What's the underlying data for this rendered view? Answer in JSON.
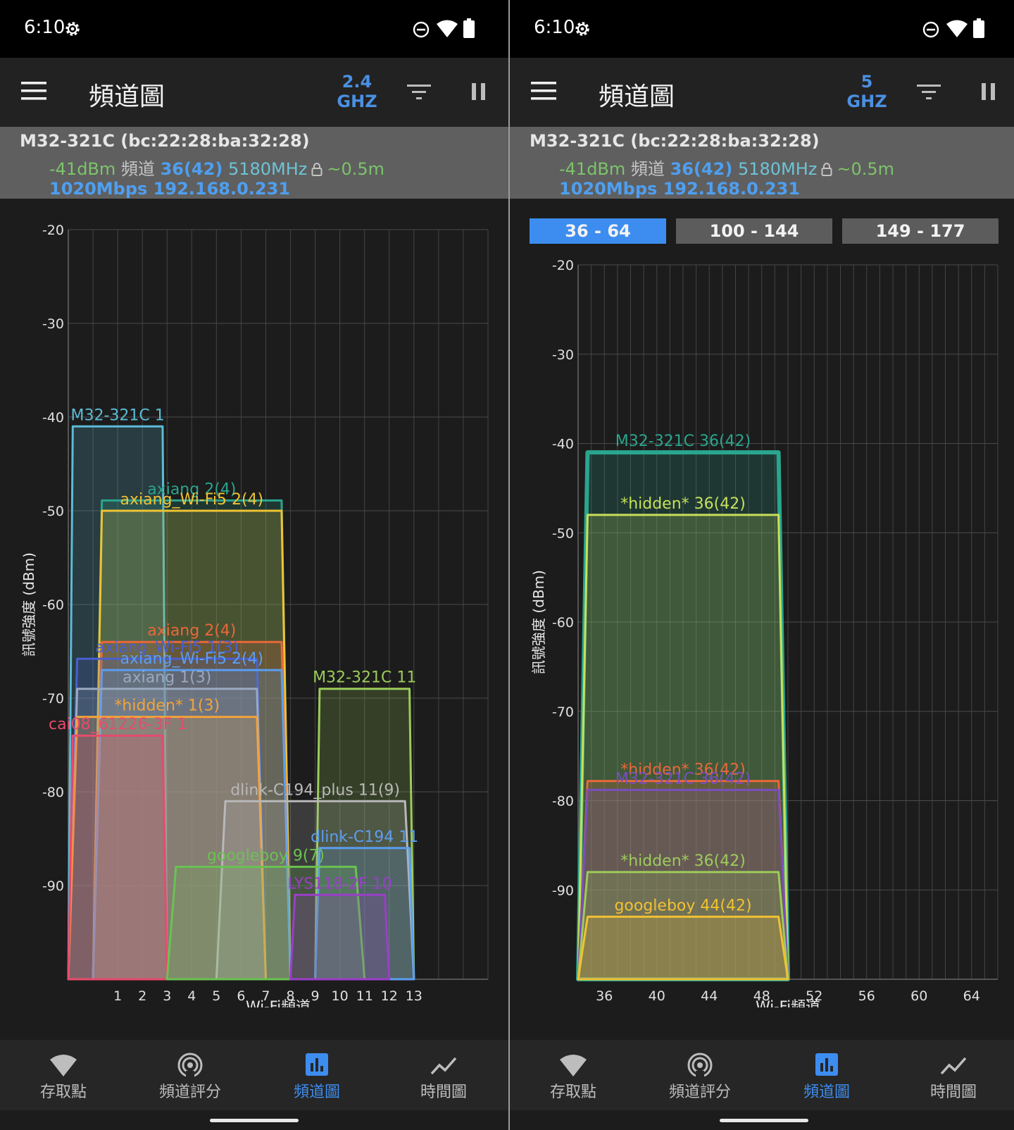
{
  "status": {
    "time": "6:10"
  },
  "app": {
    "title": "頻道圖"
  },
  "nav": [
    {
      "label": "存取點",
      "icon": "wifi-icon",
      "active": false
    },
    {
      "label": "頻道評分",
      "icon": "signal-rating-icon",
      "active": false
    },
    {
      "label": "頻道圖",
      "icon": "bar-chart-icon",
      "active": true
    },
    {
      "label": "時間圖",
      "icon": "line-chart-icon",
      "active": false
    }
  ],
  "connection": {
    "ssid": "M32-321C (bc:22:28:ba:32:28)",
    "signal": "-41dBm",
    "channel_label": "頻道",
    "channel": "36(42)",
    "frequency": "5180MHz",
    "distance": "~0.5m",
    "link": "1020Mbps 192.168.0.231"
  },
  "colors": {
    "accent": "#3d8df0",
    "signal_green": "#7cc46a",
    "ip_blue": "#4e9ff0",
    "info_bg": "#5f5f5f"
  },
  "screens": {
    "left": {
      "band_line1": "2.4",
      "band_line2": "GHZ",
      "chart_data": {
        "type": "area",
        "xlabel": "Wi-Fi頻道",
        "ylabel": "訊號強度 (dBm)",
        "ylim": [
          -100,
          -20
        ],
        "yticks": [
          -20,
          -30,
          -40,
          -50,
          -60,
          -70,
          -80,
          -90
        ],
        "xlim": [
          -1,
          16
        ],
        "xticks": [
          1,
          2,
          3,
          4,
          5,
          6,
          7,
          8,
          9,
          10,
          11,
          12,
          13
        ],
        "grid": true,
        "series": [
          {
            "name": "M32-321C 1",
            "from": -1,
            "to": 3,
            "level": -41,
            "color": "#5bbcd6"
          },
          {
            "name": "axiang 2(4)",
            "from": 0,
            "to": 8,
            "level": -48.9,
            "color": "#2aa58e"
          },
          {
            "name": "axiang_Wi-Fi5 2(4)",
            "from": 0,
            "to": 8,
            "level": -50,
            "color": "#f1c232"
          },
          {
            "name": "axiang 2(4)",
            "from": 0,
            "to": 8,
            "level": -64,
            "color": "#e9683a"
          },
          {
            "name": "axiang_Wi-Fi5 1(3)",
            "from": -1,
            "to": 7,
            "level": -65.8,
            "color": "#4a5fd0"
          },
          {
            "name": "axiang_Wi-Fi5 2(4)",
            "from": 0,
            "to": 8,
            "level": -67,
            "color": "#5b9ef0"
          },
          {
            "name": "axiang 1(3)",
            "from": -1,
            "to": 7,
            "level": -69,
            "color": "#9aa9c0"
          },
          {
            "name": "M32-321C 11",
            "from": 9,
            "to": 13,
            "level": -69,
            "color": "#9ccc5a"
          },
          {
            "name": "*hidden* 1(3)",
            "from": -1,
            "to": 7,
            "level": -72,
            "color": "#f3a33a"
          },
          {
            "name": "cai08_61226-3F 1",
            "from": -1,
            "to": 3,
            "level": -74,
            "color": "#e84a6e"
          },
          {
            "name": "dlink-C194_plus 11(9)",
            "from": 5,
            "to": 13,
            "level": -81,
            "color": "#b8b8b8"
          },
          {
            "name": "dlink-C194 11",
            "from": 9,
            "to": 13,
            "level": -86,
            "color": "#5b9ef0"
          },
          {
            "name": "googleboy 9(7)",
            "from": 3,
            "to": 11,
            "level": -88,
            "color": "#6ac252"
          },
          {
            "name": "LYS118-2F 10",
            "from": 8,
            "to": 12,
            "level": -91,
            "color": "#9b3ec8"
          }
        ]
      }
    },
    "right": {
      "band_line1": "5",
      "band_line2": "GHZ",
      "ranges": [
        "36 - 64",
        "100 - 144",
        "149 - 177"
      ],
      "active_range": 0,
      "chart_data": {
        "type": "area",
        "xlabel": "Wi-Fi頻道",
        "ylabel": "訊號強度 (dBm)",
        "ylim": [
          -100,
          -20
        ],
        "yticks": [
          -20,
          -30,
          -40,
          -50,
          -60,
          -70,
          -80,
          -90
        ],
        "xlim": [
          34,
          66
        ],
        "xticks": [
          36,
          40,
          44,
          48,
          52,
          56,
          60,
          64
        ],
        "grid": true,
        "series": [
          {
            "name": "M32-321C 36(42)",
            "from": 34,
            "to": 50,
            "level": -41,
            "color": "#2aa58e",
            "thick": true
          },
          {
            "name": "*hidden* 36(42)",
            "from": 34,
            "to": 50,
            "level": -48,
            "color": "#c6e05a"
          },
          {
            "name": "*hidden* 36(42)",
            "from": 34,
            "to": 50,
            "level": -77.8,
            "color": "#e9683a"
          },
          {
            "name": "M32-321C 36(42)",
            "from": 34,
            "to": 50,
            "level": -78.8,
            "color": "#7a4ec0"
          },
          {
            "name": "*hidden* 36(42)",
            "from": 34,
            "to": 50,
            "level": -88,
            "color": "#9ccc5a"
          },
          {
            "name": "googleboy 44(42)",
            "from": 34,
            "to": 50,
            "level": -93,
            "color": "#f1c232"
          }
        ]
      }
    }
  }
}
